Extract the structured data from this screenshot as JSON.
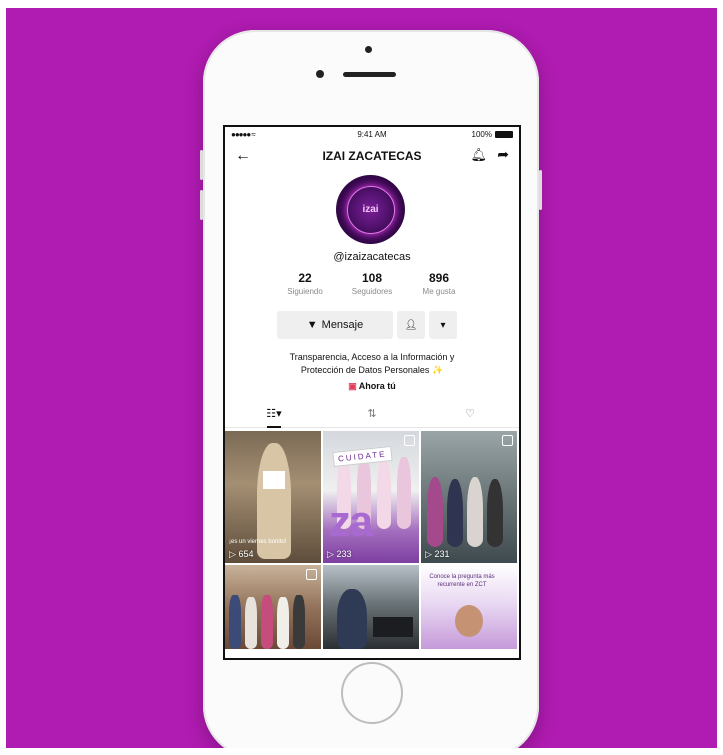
{
  "status_bar": {
    "signal": "●●●●● ≈",
    "time": "9:41 AM",
    "battery": "100%"
  },
  "profile": {
    "title": "IZAI ZACATECAS",
    "avatar_text": "izai",
    "handle": "@izaizacatecas",
    "stats": [
      {
        "value": "22",
        "label": "Siguiendo"
      },
      {
        "value": "108",
        "label": "Seguidores"
      },
      {
        "value": "896",
        "label": "Me gusta"
      }
    ],
    "message_button": "Mensaje",
    "bio_line1": "Transparencia, Acceso a la Información y",
    "bio_line2": "Protección de Datos Personales",
    "bio_emoji": "✨",
    "link_text": "Ahora tú"
  },
  "videos": [
    {
      "count": "654",
      "caption": "¡es un viernes bonito!"
    },
    {
      "count": "233",
      "overlay": "CUIDATE",
      "logo": "za"
    },
    {
      "count": "231"
    },
    {
      "count": ""
    },
    {
      "count": ""
    },
    {
      "count": "",
      "banner": "Conoce la pregunta más recurrente en ZCT"
    }
  ],
  "colors": {
    "background": "#b01bb1",
    "accent": "#e23b56"
  },
  "icons": [
    "back-icon",
    "bell-icon",
    "share-icon",
    "filter-icon",
    "add-friend-icon",
    "dropdown-icon",
    "grid-icon",
    "repost-icon",
    "liked-icon",
    "play-icon"
  ]
}
